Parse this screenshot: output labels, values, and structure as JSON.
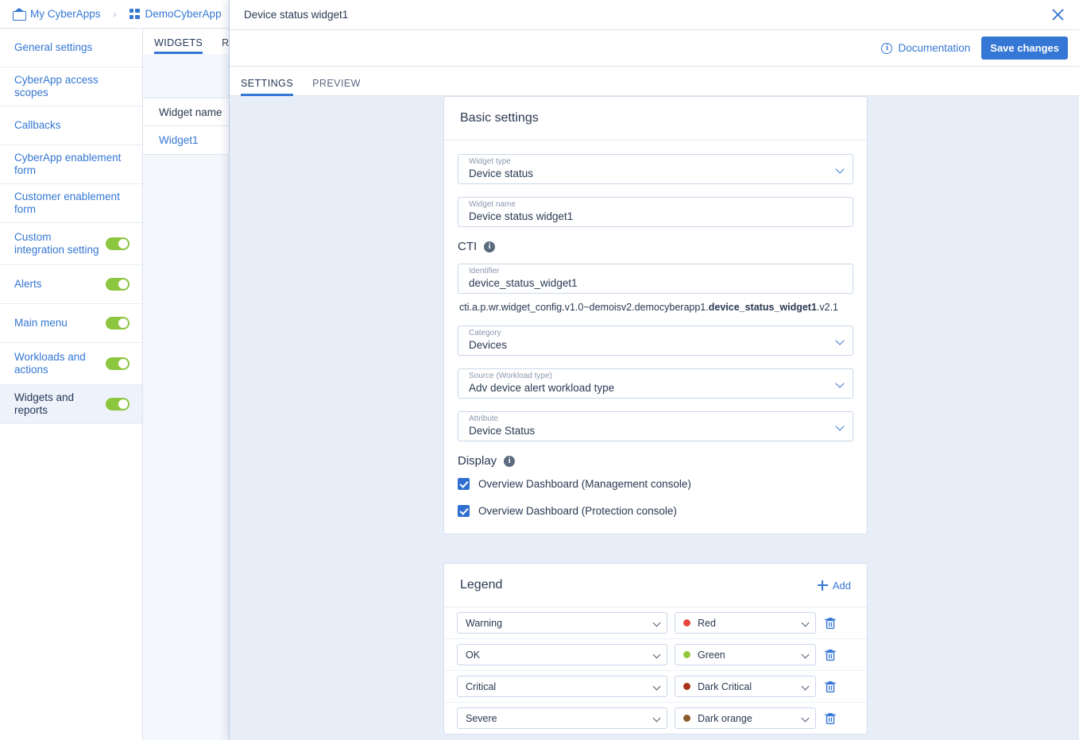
{
  "breadcrumb": {
    "items": [
      {
        "label": "My CyberApps",
        "icon": "home-icon"
      },
      {
        "label": "DemoCyberApp",
        "icon": "grid-icon"
      }
    ],
    "separator": "›"
  },
  "sidebar": {
    "items": [
      {
        "label": "General settings",
        "toggle": false
      },
      {
        "label": "CyberApp access scopes",
        "toggle": false
      },
      {
        "label": "Callbacks",
        "toggle": false
      },
      {
        "label": "CyberApp enablement form",
        "toggle": false
      },
      {
        "label": "Customer enablement form",
        "toggle": false
      },
      {
        "label": "Custom integration setting",
        "toggle": true
      },
      {
        "label": "Alerts",
        "toggle": true
      },
      {
        "label": "Main menu",
        "toggle": true
      },
      {
        "label": "Workloads and actions",
        "toggle": true
      },
      {
        "label": "Widgets and reports",
        "toggle": true,
        "selected": true
      }
    ]
  },
  "background_pane": {
    "tabs": [
      {
        "label": "WIDGETS",
        "active": true
      },
      {
        "label": "REPORTS",
        "active": false
      }
    ],
    "table": {
      "header": "Widget name",
      "rows": [
        "Widget1"
      ]
    }
  },
  "modal": {
    "title": "Device status widget1",
    "close_icon": "close-icon",
    "documentation_label": "Documentation",
    "documentation_icon": "info-circle-icon",
    "save_label": "Save changes",
    "tabs": [
      {
        "label": "SETTINGS",
        "active": true
      },
      {
        "label": "PREVIEW",
        "active": false
      }
    ],
    "basic_settings": {
      "title": "Basic settings",
      "fields": [
        {
          "label": "Widget type",
          "value": "Device status",
          "type": "select"
        },
        {
          "label": "Widget name",
          "value": "Device status widget1",
          "type": "text"
        }
      ],
      "cti": {
        "label": "CTI",
        "info_icon": "info-icon",
        "identifier_label": "Identifier",
        "identifier_value": "device_status_widget1",
        "path_prefix": "cti.a.p.wr.widget_config.v1.0~demoisv2.democyberapp1.",
        "path_bold": "device_status_widget1",
        "path_suffix": ".v2.1"
      },
      "selects": [
        {
          "label": "Category",
          "value": "Devices"
        },
        {
          "label": "Source (Workload type)",
          "value": "Adv device alert workload type"
        },
        {
          "label": "Attribute",
          "value": "Device Status"
        }
      ],
      "display": {
        "label": "Display",
        "info_icon": "info-icon",
        "checkboxes": [
          {
            "label": "Overview Dashboard (Management console)",
            "checked": true
          },
          {
            "label": "Overview Dashboard (Protection console)",
            "checked": true
          }
        ]
      }
    },
    "legend": {
      "title": "Legend",
      "add_label": "Add",
      "add_icon": "plus-icon",
      "delete_icon": "trash-icon",
      "rows": [
        {
          "name": "Warning",
          "color_name": "Red",
          "color_hex": "#e8473f"
        },
        {
          "name": "OK",
          "color_name": "Green",
          "color_hex": "#93c83d"
        },
        {
          "name": "Critical",
          "color_name": "Dark Critical",
          "color_hex": "#a8321b"
        },
        {
          "name": "Severe",
          "color_name": "Dark orange",
          "color_hex": "#8c5b2a"
        }
      ]
    }
  },
  "theme": {
    "accent": "#3577d4",
    "toggle_on": "#8cc63e",
    "modal_body_bg": "#e8eef8",
    "checkbox": "#2f6fd0"
  }
}
